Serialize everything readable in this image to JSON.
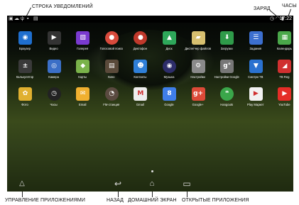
{
  "callouts": {
    "notifications": "СТРОКА УВЕДОМЛЕНИЙ",
    "battery": "ЗАРЯД",
    "clock": "ЧАСЫ",
    "app_manager": "УПРАВЛЕНИЕ ПРИЛОЖЕНИЯМИ",
    "back": "НАЗАД",
    "home": "ДОМАШНИЙ ЭКРАН",
    "recents": "ОТКРЫТЫЕ ПРИЛОЖЕНИЯ"
  },
  "status_bar": {
    "time": "17:22",
    "left_icons": [
      "image-icon",
      "cloud-icon",
      "usb-icon",
      "notification-icon",
      "download-icon"
    ],
    "right_icons": [
      "alarm-icon",
      "wifi-icon",
      "battery-icon"
    ]
  },
  "apps": [
    {
      "label": "Браузер",
      "icon": "globe-icon",
      "color": "#1f6fcf"
    },
    {
      "label": "Видео",
      "icon": "clapper-icon",
      "color": "#333333"
    },
    {
      "label": "Галерея",
      "icon": "gallery-icon",
      "color": "#7a3ad0"
    },
    {
      "label": "Голосовой поиск",
      "icon": "mic-icon",
      "color": "#d84a3c"
    },
    {
      "label": "Диктофон",
      "icon": "recorder-icon",
      "color": "#c0392b"
    },
    {
      "label": "Диск",
      "icon": "drive-icon",
      "color": "#2ea75a"
    },
    {
      "label": "Диспетчер файлов",
      "icon": "folder-icon",
      "color": "#d8c070"
    },
    {
      "label": "Загрузки",
      "icon": "download-icon",
      "color": "#2f9b4a"
    },
    {
      "label": "Задания",
      "icon": "tasks-icon",
      "color": "#3c6fcf"
    },
    {
      "label": "Календарь",
      "icon": "calendar-icon",
      "color": "#4aa84a"
    },
    {
      "label": "Калькулятор",
      "icon": "calculator-icon",
      "color": "#3a3a3a"
    },
    {
      "label": "Камера",
      "icon": "camera-icon",
      "color": "#3b6fc7"
    },
    {
      "label": "Карты",
      "icon": "maps-icon",
      "color": "#7ab34a"
    },
    {
      "label": "Кино",
      "icon": "film-icon",
      "color": "#5a4a3a"
    },
    {
      "label": "Контакты",
      "icon": "contacts-icon",
      "color": "#2f7fd8"
    },
    {
      "label": "Музыка",
      "icon": "music-icon",
      "color": "#2d2d6a"
    },
    {
      "label": "Настройки",
      "icon": "settings-icon",
      "color": "#8a8a8a"
    },
    {
      "label": "Настройки Google",
      "icon": "google-settings-icon",
      "color": "#777777"
    },
    {
      "label": "Смотри ТВ",
      "icon": "tv-icon",
      "color": "#2a72d0"
    },
    {
      "label": "TB Reg",
      "icon": "tb-icon",
      "color": "#d03030"
    },
    {
      "label": "Фото",
      "icon": "photos-icon",
      "color": "#e0b030"
    },
    {
      "label": "Часы",
      "icon": "clock-icon",
      "color": "#222222"
    },
    {
      "label": "Email",
      "icon": "email-icon",
      "color": "#f0b030"
    },
    {
      "label": "FM-станция",
      "icon": "radio-icon",
      "color": "#5a4a40"
    },
    {
      "label": "Gmail",
      "icon": "gmail-icon",
      "color": "#eeeeee"
    },
    {
      "label": "Google",
      "icon": "google-icon",
      "color": "#3f7ee8"
    },
    {
      "label": "Google+",
      "icon": "googleplus-icon",
      "color": "#dc4a38"
    },
    {
      "label": "Hangouts",
      "icon": "hangouts-icon",
      "color": "#3aa64a"
    },
    {
      "label": "Play Маркет",
      "icon": "play-store-icon",
      "color": "#f2f2f2"
    },
    {
      "label": "YouTube",
      "icon": "youtube-icon",
      "color": "#e52d27"
    }
  ],
  "icon_glyphs": [
    "◉",
    "▶",
    "▧",
    "●",
    "●",
    "▲",
    "▰",
    "⬇",
    "☰",
    "▦",
    "±",
    "◎",
    "◆",
    "▤",
    "☻",
    "◉",
    "⚙",
    "g°",
    "▼",
    "◢",
    "✿",
    "◷",
    "✉",
    "◔",
    "M",
    "8",
    "g+",
    "❝",
    "▶",
    "▶"
  ],
  "navigation": {
    "app_manager_icon": "caret-up-icon",
    "back_icon": "back-arrow-icon",
    "home_icon": "home-icon",
    "recents_icon": "recents-icon"
  }
}
